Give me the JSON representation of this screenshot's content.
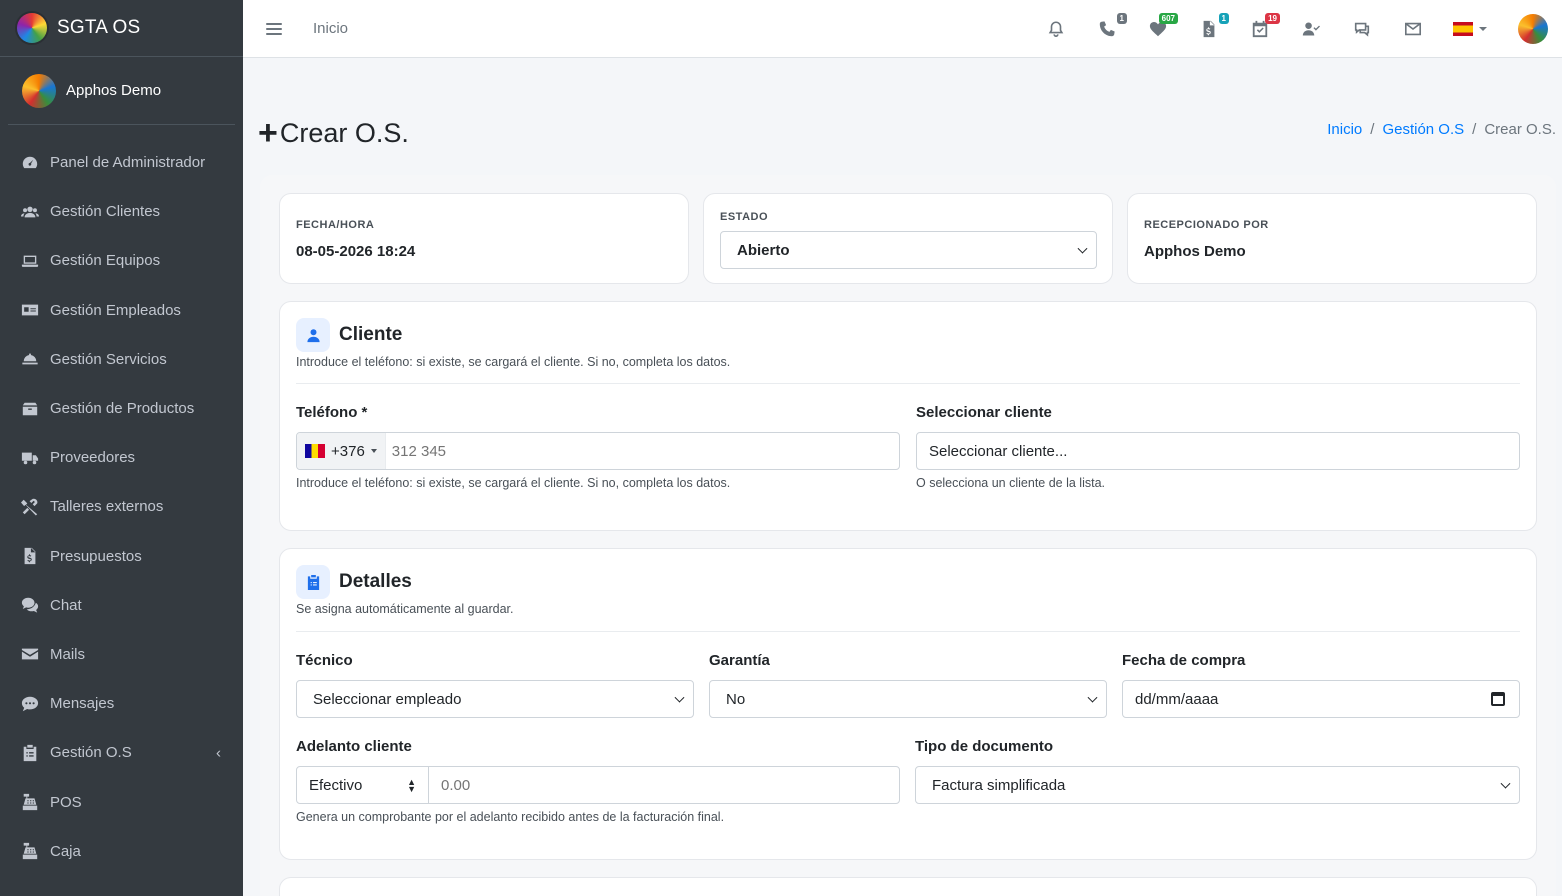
{
  "sidebar": {
    "brand": "SGTA OS",
    "user": "Apphos Demo",
    "items": [
      {
        "label": "Panel de Administrador",
        "icon": "tachometer-icon"
      },
      {
        "label": "Gestión Clientes",
        "icon": "users-icon"
      },
      {
        "label": "Gestión Equipos",
        "icon": "laptop-icon"
      },
      {
        "label": "Gestión Empleados",
        "icon": "id-card-icon"
      },
      {
        "label": "Gestión Servicios",
        "icon": "concierge-bell-icon"
      },
      {
        "label": "Gestión de Productos",
        "icon": "box-icon"
      },
      {
        "label": "Proveedores",
        "icon": "truck-icon"
      },
      {
        "label": "Talleres externos",
        "icon": "tools-icon"
      },
      {
        "label": "Presupuestos",
        "icon": "file-invoice-dollar-icon"
      },
      {
        "label": "Chat",
        "icon": "comments-icon"
      },
      {
        "label": "Mails",
        "icon": "envelope-icon"
      },
      {
        "label": "Mensajes",
        "icon": "comment-dots-icon"
      },
      {
        "label": "Gestión O.S",
        "icon": "clipboard-list-icon"
      },
      {
        "label": "POS",
        "icon": "cash-register-icon"
      },
      {
        "label": "Caja",
        "icon": "cash-register-icon"
      }
    ]
  },
  "navbar": {
    "home": "Inicio",
    "badges": {
      "phone": "1",
      "heart": "607",
      "invoice": "1",
      "check": "19"
    }
  },
  "page": {
    "title": "Crear O.S.",
    "breadcrumb": [
      "Inicio",
      "Gestión O.S",
      "Crear O.S."
    ]
  },
  "summary": {
    "fecha_label": "FECHA/HORA",
    "fecha_value": "08-05-2026 18:24",
    "estado_label": "ESTADO",
    "estado_value": "Abierto",
    "recep_label": "RECEPCIONADO POR",
    "recep_value": "Apphos Demo"
  },
  "cliente": {
    "title": "Cliente",
    "subtitle": "Introduce el teléfono: si existe, se cargará el cliente. Si no, completa los datos.",
    "telefono_label": "Teléfono *",
    "dial_code": "+376",
    "telefono_placeholder": "312 345",
    "telefono_help": "Introduce el teléfono: si existe, se cargará el cliente. Si no, completa los datos.",
    "select_label": "Seleccionar cliente",
    "select_value": "Seleccionar cliente...",
    "select_help": "O selecciona un cliente de la lista."
  },
  "detalles": {
    "title": "Detalles",
    "subtitle": "Se asigna automáticamente al guardar.",
    "tecnico_label": "Técnico",
    "tecnico_value": "Seleccionar empleado",
    "garantia_label": "Garantía",
    "garantia_value": "No",
    "fecha_compra_label": "Fecha de compra",
    "fecha_compra_placeholder": "dd/mm/aaaa",
    "adelanto_label": "Adelanto cliente",
    "adelanto_method": "Efectivo",
    "adelanto_placeholder": "0.00",
    "adelanto_help": "Genera un comprobante por el adelanto recibido antes de la facturación final.",
    "tipo_doc_label": "Tipo de documento",
    "tipo_doc_value": "Factura simplificada"
  }
}
